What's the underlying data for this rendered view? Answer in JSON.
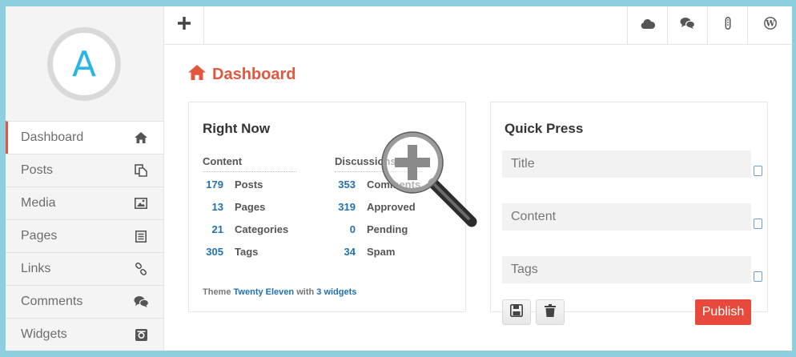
{
  "avatar": {
    "letter": "A"
  },
  "sidebar": {
    "items": [
      {
        "label": "Dashboard",
        "icon": "home-icon",
        "active": true
      },
      {
        "label": "Posts",
        "icon": "posts-icon",
        "active": false
      },
      {
        "label": "Media",
        "icon": "image-icon",
        "active": false
      },
      {
        "label": "Pages",
        "icon": "page-icon",
        "active": false
      },
      {
        "label": "Links",
        "icon": "link-icon",
        "active": false
      },
      {
        "label": "Comments",
        "icon": "comments-icon",
        "active": false
      },
      {
        "label": "Widgets",
        "icon": "widgets-icon",
        "active": false
      }
    ]
  },
  "topbar": {
    "left_icon": "plus-icon",
    "right_icons": [
      "cloud-icon",
      "comments-icon",
      "thermometer-icon",
      "wordpress-icon"
    ]
  },
  "page": {
    "title": "Dashboard",
    "title_icon": "home-icon"
  },
  "right_now": {
    "title": "Right Now",
    "content": {
      "heading": "Content",
      "rows": [
        {
          "count": "179",
          "label": "Posts"
        },
        {
          "count": "13",
          "label": "Pages"
        },
        {
          "count": "21",
          "label": "Categories"
        },
        {
          "count": "305",
          "label": "Tags"
        }
      ]
    },
    "discussions": {
      "heading": "Discussions",
      "rows": [
        {
          "count": "353",
          "label": "Comments"
        },
        {
          "count": "319",
          "label": "Approved"
        },
        {
          "count": "0",
          "label": "Pending"
        },
        {
          "count": "34",
          "label": "Spam"
        }
      ]
    },
    "theme": {
      "prefix": "Theme",
      "theme_name": "Twenty Eleven",
      "middle": "with",
      "widgets_link": "3 widgets"
    }
  },
  "quick_press": {
    "title": "Quick Press",
    "fields": [
      {
        "placeholder": "Title"
      },
      {
        "placeholder": "Content"
      },
      {
        "placeholder": "Tags"
      }
    ],
    "save_icon": "save-icon",
    "delete_icon": "trash-icon",
    "publish_label": "Publish"
  },
  "colors": {
    "accent": "#e2583f",
    "link": "#2271b1",
    "avatar_letter": "#29b6e6",
    "frame_border": "#8ecfdf",
    "publish_bg": "#e8493d"
  }
}
